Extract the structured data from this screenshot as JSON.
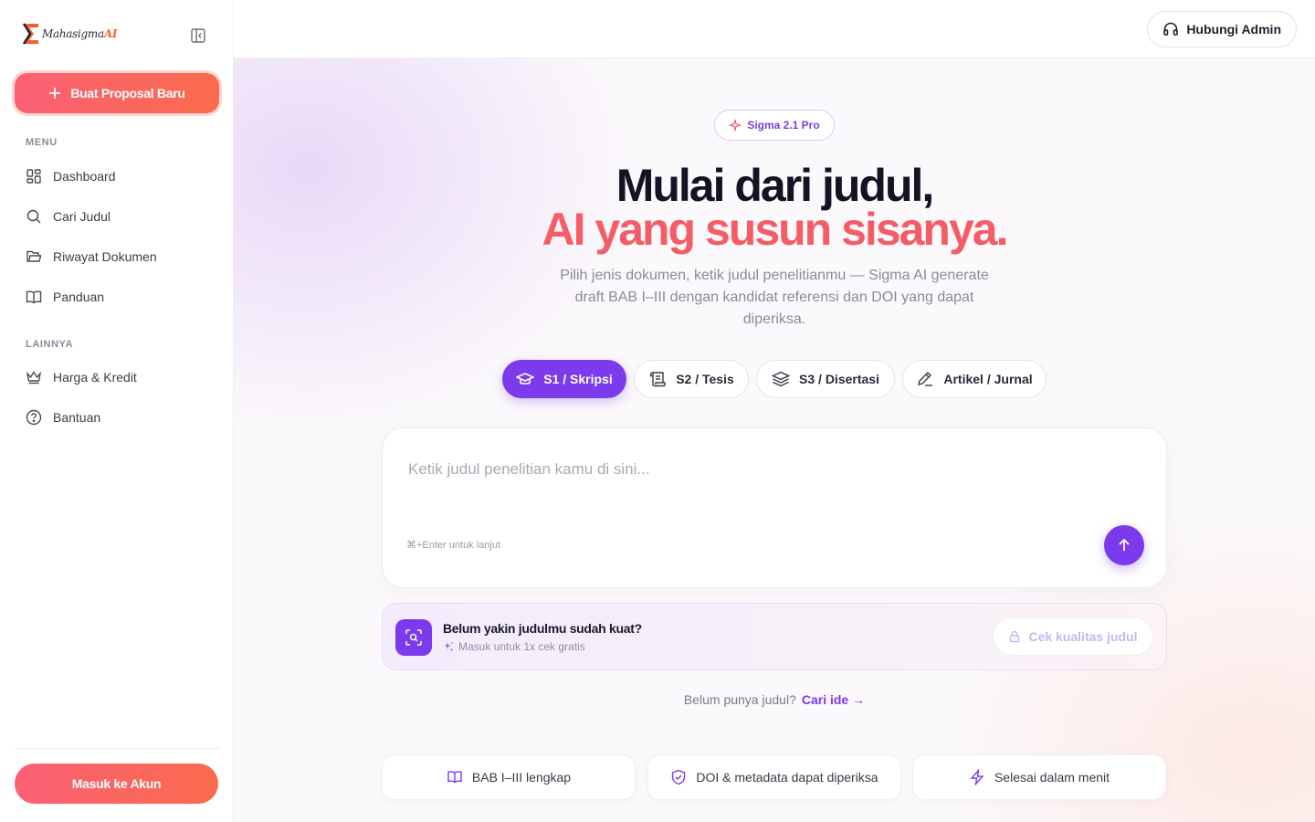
{
  "brand": {
    "name": "Mahasigma",
    "suffix": "AI"
  },
  "sidebar": {
    "new_button": "Buat Proposal Baru",
    "menu_label": "MENU",
    "menu_items": [
      {
        "label": "Dashboard",
        "icon": "dashboard-icon"
      },
      {
        "label": "Cari Judul",
        "icon": "search-icon"
      },
      {
        "label": "Riwayat Dokumen",
        "icon": "folder-icon"
      },
      {
        "label": "Panduan",
        "icon": "book-icon"
      }
    ],
    "other_label": "LAINNYA",
    "other_items": [
      {
        "label": "Harga & Kredit",
        "icon": "crown-icon"
      },
      {
        "label": "Bantuan",
        "icon": "help-circle-icon"
      }
    ],
    "login_button": "Masuk ke Akun"
  },
  "topbar": {
    "admin_button": "Hubungi Admin"
  },
  "main": {
    "badge": "Sigma 2.1 Pro",
    "hero_line1": "Mulai dari judul,",
    "hero_line2": "AI yang susun sisanya.",
    "subtitle": "Pilih jenis dokumen, ketik judul penelitianmu — Sigma AI generate draft BAB I–III dengan kandidat referensi dan DOI yang dapat diperiksa.",
    "doc_types": [
      {
        "label": "S1 / Skripsi",
        "icon": "graduation-cap-icon",
        "active": true
      },
      {
        "label": "S2 / Tesis",
        "icon": "scroll-icon",
        "active": false
      },
      {
        "label": "S3 / Disertasi",
        "icon": "layers-icon",
        "active": false
      },
      {
        "label": "Artikel / Jurnal",
        "icon": "pen-icon",
        "active": false
      }
    ],
    "input": {
      "placeholder": "Ketik judul penelitian kamu di sini...",
      "hint": "⌘+Enter untuk lanjut"
    },
    "quality": {
      "title": "Belum yakin judulmu sudah kuat?",
      "subtitle": "Masuk untuk 1x cek gratis",
      "button": "Cek kualitas judul"
    },
    "no_title": {
      "text": "Belum punya judul?",
      "link": "Cari ide →"
    },
    "features": [
      {
        "label": "BAB I–III lengkap",
        "icon": "book-open-icon"
      },
      {
        "label": "DOI & metadata dapat diperiksa",
        "icon": "shield-check-icon"
      },
      {
        "label": "Selesai dalam menit",
        "icon": "lightning-icon"
      }
    ]
  },
  "colors": {
    "accent": "#7c3aed",
    "brand_gradient_start": "#fb6075",
    "brand_gradient_end": "#f96b4d",
    "hero_accent": "#f55d66"
  }
}
